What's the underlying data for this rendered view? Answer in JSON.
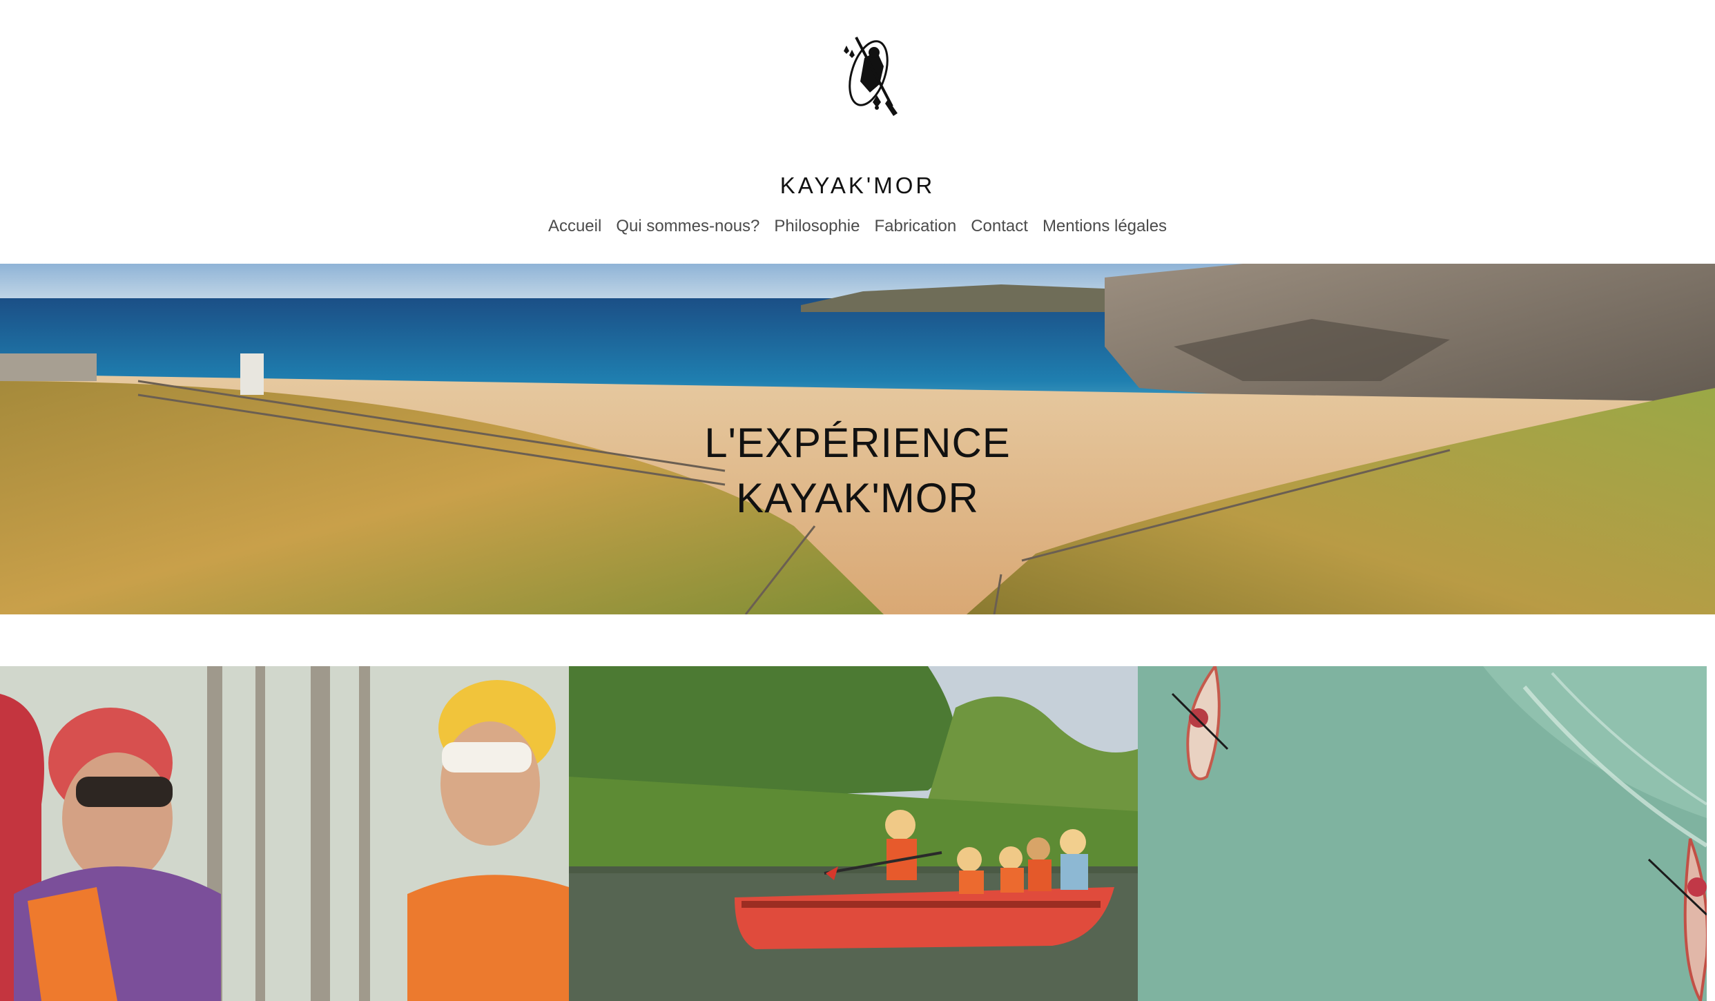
{
  "site": {
    "title": "KAYAK'MOR",
    "logo_icon": "kayaker-ermine-logo-icon"
  },
  "nav": {
    "items": [
      {
        "label": "Accueil"
      },
      {
        "label": "Qui sommes-nous?"
      },
      {
        "label": "Philosophie"
      },
      {
        "label": "Fabrication"
      },
      {
        "label": "Contact"
      },
      {
        "label": "Mentions légales"
      }
    ]
  },
  "hero": {
    "line1": "L'EXPÉRIENCE",
    "line2": "KAYAK'MOR",
    "image": "coastal-beach-dunes-photo"
  },
  "gallery": {
    "images": [
      {
        "subject": "two-women-helmets-life-jackets-photo"
      },
      {
        "subject": "family-red-canoe-river-photo"
      },
      {
        "subject": "aerial-kayaks-green-water-photo"
      }
    ]
  },
  "colors": {
    "text": "#111111",
    "nav_text": "#4b4b4b",
    "background": "#ffffff"
  }
}
